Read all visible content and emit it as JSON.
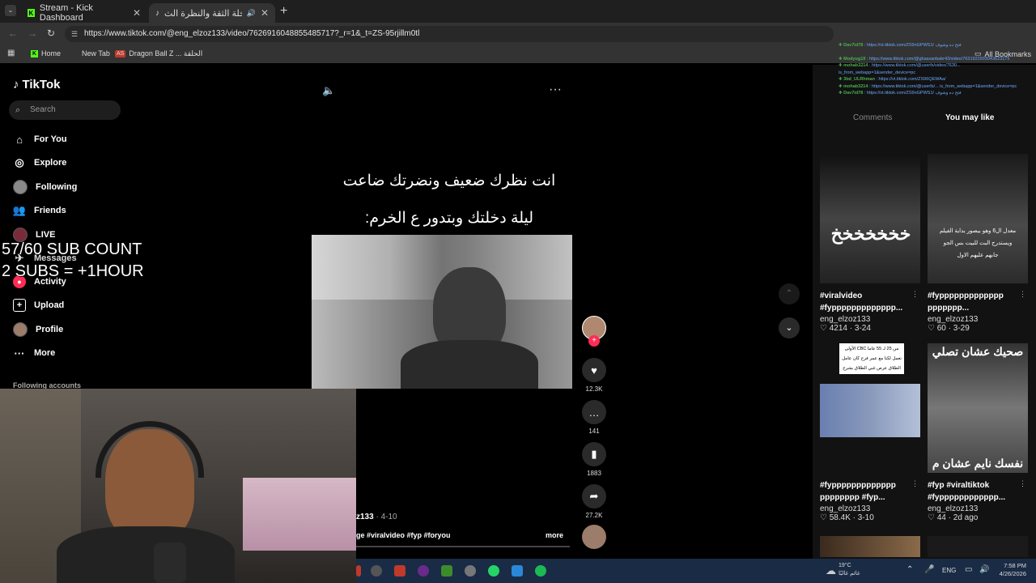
{
  "tabs": [
    {
      "label": "Stream - Kick Dashboard"
    },
    {
      "label": "ليلة الدخلة الثقة والنظرة الث..."
    }
  ],
  "url": "https://www.tiktok.com/@eng_elzoz133/video/7626916048855485717?_r=1&_t=ZS-95rjillm0tl",
  "bookmarks": {
    "home": "Home",
    "newtab": "New Tab",
    "dragon": "Dragon Ball Z ... الحلقة",
    "dragon_icon": "AS",
    "all": "All Bookmarks"
  },
  "tiktok": {
    "logo": "TikTok",
    "search_placeholder": "Search",
    "nav": [
      {
        "label": "For You",
        "icon": "home-icon"
      },
      {
        "label": "Explore",
        "icon": "compass-icon"
      },
      {
        "label": "Following",
        "icon": "avatar-icon"
      },
      {
        "label": "Friends",
        "icon": "friends-icon"
      },
      {
        "label": "LIVE",
        "icon": "live-icon"
      },
      {
        "label": "Messages",
        "icon": "message-icon"
      },
      {
        "label": "Activity",
        "icon": "bell-icon"
      },
      {
        "label": "Upload",
        "icon": "plus-square-icon"
      },
      {
        "label": "Profile",
        "icon": "avatar-icon"
      },
      {
        "label": "More",
        "icon": "more-icon"
      }
    ],
    "following_accounts": "Following accounts"
  },
  "overlay": {
    "line1": "57/60 SUB COUNT",
    "line2": "2 SUBS = +1HOUR"
  },
  "video": {
    "caption_line1": "انت نظرك ضعيف ونضرتك ضاعت",
    "caption_line2": "ليلة دخلتك وبتدور ع الخرم:",
    "author_fragment": "z133",
    "date": "4-10",
    "tags": "ge #viralvideo #fyp #foryou",
    "more": "more"
  },
  "actions": {
    "likes": "12.3K",
    "comments": "141",
    "saves": "1883",
    "shares": "27.2K"
  },
  "right": {
    "comments_tab": "Comments",
    "you_may_like": "You may like",
    "cards": [
      {
        "title": "#viralvideo #fyppppppppppppp...",
        "user": "eng_elzoz133",
        "likes": "4214",
        "date": "3-24",
        "thumb_text": "خخخخخخخ"
      },
      {
        "title": "#fyppppppppppppp ppppppp...",
        "user": "eng_elzoz133",
        "likes": "60",
        "date": "3-29",
        "thumb_text": "معدل ال6 وهو بيصور بداية الفيلم ويستدرج البت للبيت بس الجو جابهم عليهم الاول"
      },
      {
        "title": "#fyppppppppppppp pppppppp #fyp...",
        "user": "eng_elzoz133",
        "likes": "58.4K",
        "date": "3-10",
        "thumb_text": "من 25 لـ 55 عاما CBC الأولى تعمل لكنا مع عمر فرح كان عامل الطلاق عرص غبي الطلاق بشرح"
      },
      {
        "title": "#fyp #viraltiktok #fypppppppppppp...",
        "user": "eng_elzoz133",
        "likes": "44",
        "date": "2d ago",
        "thumb_text_top": "صحيك عشان تصلي",
        "thumb_text_bottom": "نفسك نايم عشان م"
      }
    ]
  },
  "chat": [
    {
      "user": "Dav7id78",
      "msg": "https://vt.tiktok.com/ZS9nGPWS1/ فتح ده وشوف"
    },
    {
      "user": "Modyug19",
      "msg": "https://www.tiktok.com/@ghassanbakr43/video/7631922993043623175"
    },
    {
      "user": "mohab3214",
      "msg": "https://www.tiktok.com/@userfs/video/7630... is_from_webapp=1&sender_device=pc"
    },
    {
      "user": "3bd_ULRhman",
      "msg": "https://vt.tiktok.com/ZS96QEWAa/"
    },
    {
      "user": "mohab3214",
      "msg": "https://www.tiktok.com/@userfs/... is_from_webapp=1&sender_device=pc"
    },
    {
      "user": "Dav7id78",
      "msg": "https://vt.tiktok.com/ZS9nGPWS1/ فتح ده وشوف"
    }
  ],
  "taskbar": {
    "weather_temp": "19°C",
    "weather_desc": "غائم غالبًا",
    "lang": "ENG",
    "time": "7:58 PM",
    "date": "4/26/2026"
  },
  "colors": {
    "accent": "#fe2c55",
    "chat_green": "#4caf50",
    "chat_link": "#6aa9ff"
  }
}
